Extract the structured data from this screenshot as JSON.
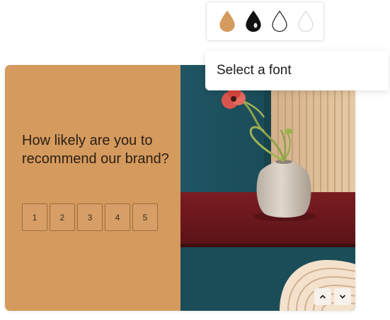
{
  "colors": {
    "swatches": [
      {
        "name": "tan-swatch",
        "fill": "#d59a5e",
        "stroke": "#d59a5e"
      },
      {
        "name": "black-swatch",
        "fill": "#111111",
        "stroke": "#111111"
      },
      {
        "name": "white-swatch",
        "fill": "#ffffff",
        "stroke": "#2a2a2a"
      },
      {
        "name": "light-swatch",
        "fill": "#ffffff",
        "stroke": "#d9d9d9"
      }
    ],
    "card_background": "#d59a5e"
  },
  "font_select": {
    "placeholder": "Select a font"
  },
  "survey": {
    "question": "How likely are you to recommend our brand?",
    "scale": [
      "1",
      "2",
      "3",
      "4",
      "5"
    ]
  },
  "navigation": {
    "up_icon": "chevron-up-icon",
    "down_icon": "chevron-down-icon"
  }
}
